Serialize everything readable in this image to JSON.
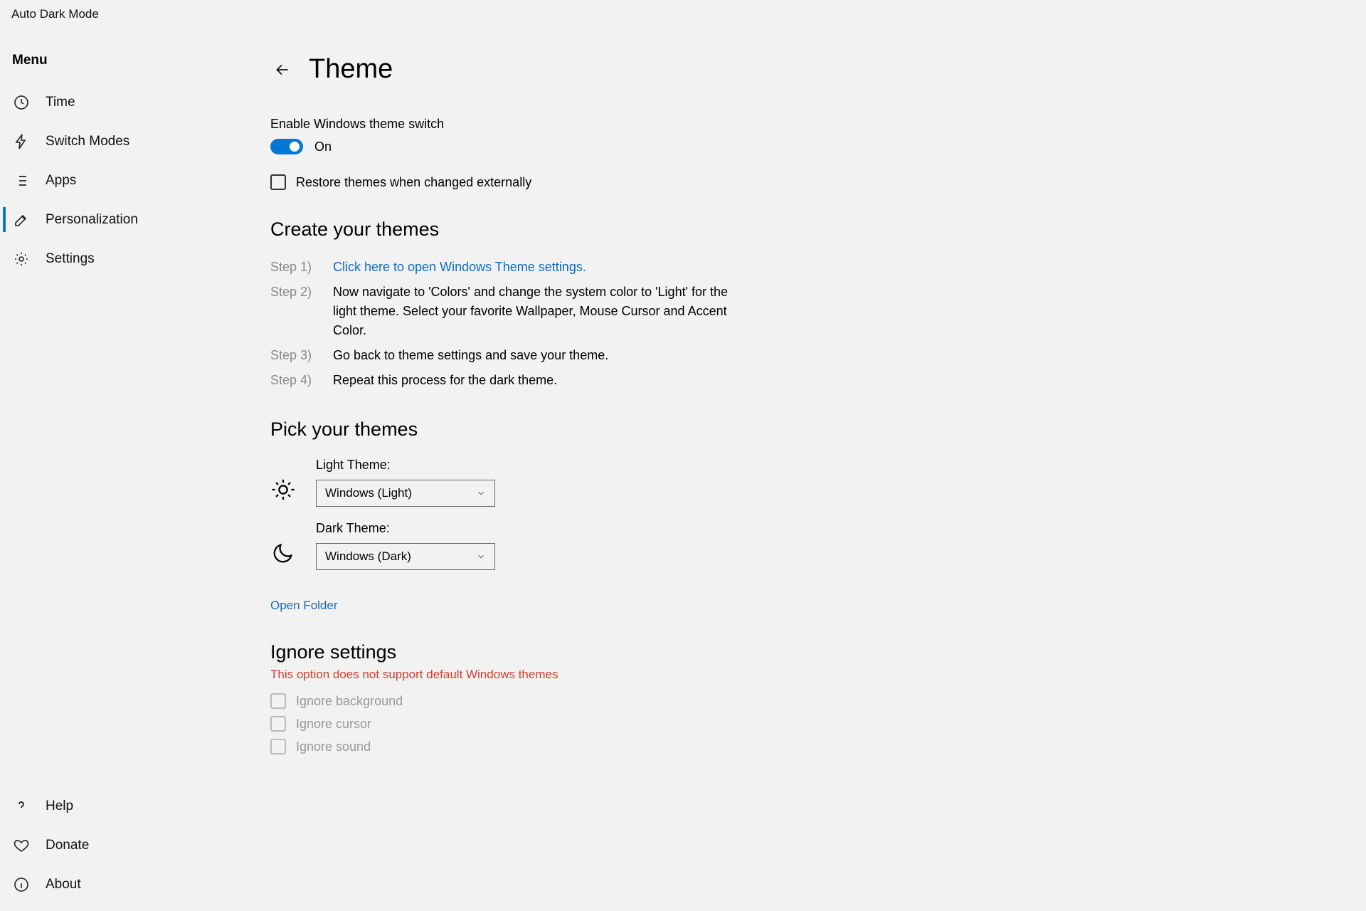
{
  "app": {
    "title": "Auto Dark Mode"
  },
  "sidebar": {
    "menu_label": "Menu",
    "nav": [
      {
        "label": "Time"
      },
      {
        "label": "Switch Modes"
      },
      {
        "label": "Apps"
      },
      {
        "label": "Personalization"
      },
      {
        "label": "Settings"
      }
    ],
    "bottom": [
      {
        "label": "Help"
      },
      {
        "label": "Donate"
      },
      {
        "label": "About"
      }
    ]
  },
  "page": {
    "title": "Theme",
    "enable_label": "Enable Windows theme switch",
    "enable_state": "On",
    "restore_label": "Restore themes when changed externally",
    "section_create": "Create your themes",
    "steps": [
      {
        "n": "Step 1)",
        "link": "Click here to open Windows Theme settings."
      },
      {
        "n": "Step 2)",
        "text": "Now navigate to 'Colors' and change the system color to 'Light' for the light theme. Select your favorite Wallpaper, Mouse Cursor and Accent Color."
      },
      {
        "n": "Step 3)",
        "text": "Go back to theme settings and save your theme."
      },
      {
        "n": "Step 4)",
        "text": "Repeat this process for the dark theme."
      }
    ],
    "section_pick": "Pick your themes",
    "light_label": "Light Theme:",
    "light_value": "Windows (Light)",
    "dark_label": "Dark Theme:",
    "dark_value": "Windows (Dark)",
    "open_folder": "Open Folder",
    "section_ignore": "Ignore settings",
    "ignore_warning": "This option does not support default Windows themes",
    "ignore": [
      "Ignore background",
      "Ignore cursor",
      "Ignore sound"
    ]
  }
}
